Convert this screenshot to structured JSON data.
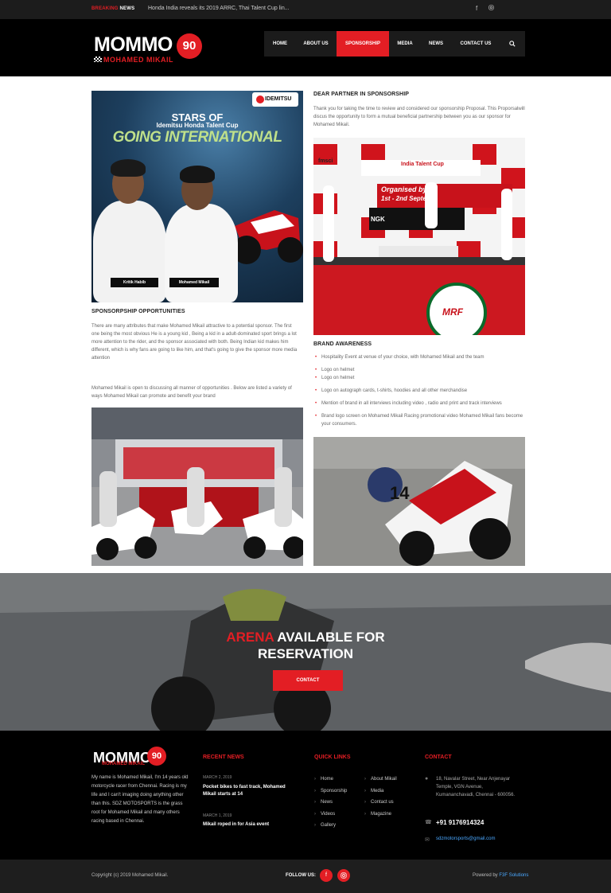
{
  "topbar": {
    "breaking_label_1": "BREAKING",
    "breaking_label_2": "NEWS",
    "ticker_text": "Honda India reveals its 2019 ARRC, Thai Talent Cup lin...",
    "social_icons": [
      "facebook-icon",
      "instagram-icon"
    ]
  },
  "header": {
    "logo_text": "MOMMO",
    "logo_number": "90",
    "logo_subtitle": "MOHAMED MIKAIL",
    "nav": [
      {
        "label": "HOME",
        "active": false
      },
      {
        "label": "ABOUT US",
        "active": false
      },
      {
        "label": "SPONSORSHIP",
        "active": true
      },
      {
        "label": "MEDIA",
        "active": false
      },
      {
        "label": "NEWS",
        "active": false
      },
      {
        "label": "CONTACT US",
        "active": false
      }
    ],
    "search_icon": "search-icon"
  },
  "promo": {
    "brand": "IDEMITSU",
    "stars": "STARS OF",
    "cup": "Idemitsu Honda Talent Cup",
    "going": "GOING INTERNATIONAL",
    "name_1": "Kritik Habib",
    "name_2": "Mohamed Mikail"
  },
  "sponsorship": {
    "title": "SPONSORPSHIP OPPORTUNITIES",
    "para_1": "There are many attributes that make Mohamed  Mikail attractive to a potential sponsor. The first one being  the most obvious He is a young kid , Being a kid in a  adult-dominated sport brings a lot  more attention  to the rider, and the sponsor associated with both. Being Indian kid makes him different, which is why fans are going to  like him, and that's going to give the sponsor more media attention",
    "para_2": "Mohamed Mikail is open to discussing all manner of opportunities . Below are listed a variety of ways Mohamed Mikail can promote and benefit your brand"
  },
  "partner": {
    "title": "DEAR PARTNER IN SPONSORSHIP",
    "text": "Thank you for taking  the time to review and considered our sponsorship Proposal. This Proporsalwill discus the opportunity to form a mutual beneficial partnership between you as our sponsor for  Mohamed Mikail."
  },
  "podium": {
    "banner_text": "India Talent Cup",
    "organised": "Organised by M",
    "dates": "1st - 2nd Septem",
    "brands": [
      "HONDA",
      "NGK",
      "fmsci",
      "MRF"
    ]
  },
  "brand_awareness": {
    "title": "BRAND AWARENESS",
    "items": [
      "Hospitality Event at venue of your choice, with Mohamed Mikail and the team",
      "Logo on helmet",
      "Logo on helmet",
      "Logo on autograph cards, t-shirts, hoodies and all other merchandise",
      "Mention of brand in all interviews including video , radio and print and track interviews",
      "Brand logo screen on Mohamed Mikail Racing promotional video Mohamed Mikail fans become your consumers."
    ]
  },
  "cta": {
    "title_red": "ARENA",
    "title_rest": " AVAILABLE FOR",
    "title_line2": "RESERVATION",
    "button": "CONTACT"
  },
  "footer": {
    "logo_text": "MOMMO",
    "logo_number": "90",
    "logo_subtitle": "MOHAMED MIKAIL",
    "about": "My name is Mohamed Mikail, I'm 14 years old motorcycle racer from Chennai. Racing is my life and I can't imaging doing anything other than this. SDZ MOTOSPORTS is the grass root for Mohamed Mikail and many others racing based in Chennai.",
    "recent_news_title": "RECENT NEWS",
    "news": [
      {
        "date": "MARCH 2, 2019",
        "title": "Pocket bikes to fast track, Mohamed Mikail starts at 14"
      },
      {
        "date": "MARCH 1, 2019",
        "title": "Mikail roped in for Asia event"
      }
    ],
    "quick_links_title": "QUICK LINKS",
    "links_col1": [
      "Home",
      "Sponsorship",
      "News",
      "Videos",
      "Gallery"
    ],
    "links_col2": [
      "About Mikail",
      "Media",
      "Contact us",
      "Magazine"
    ],
    "contact_title": "CONTACT",
    "address": "18, Navalar Street, Near Anjenayar Temple, VGN Avenue, Kumananchavadi, Chennai - 600056.",
    "phone": "+91 9176914324",
    "email": "sdzmotorsports@gmail.com"
  },
  "bottombar": {
    "copyright": "Copyright (c) 2019 Mohamed Mikail.",
    "follow": "FOLLOW US:",
    "powered_prefix": "Powered by ",
    "powered_name": "F3F Solutions"
  },
  "colors": {
    "accent": "#e31e24",
    "dark": "#000000",
    "link": "#4aa8ff"
  }
}
